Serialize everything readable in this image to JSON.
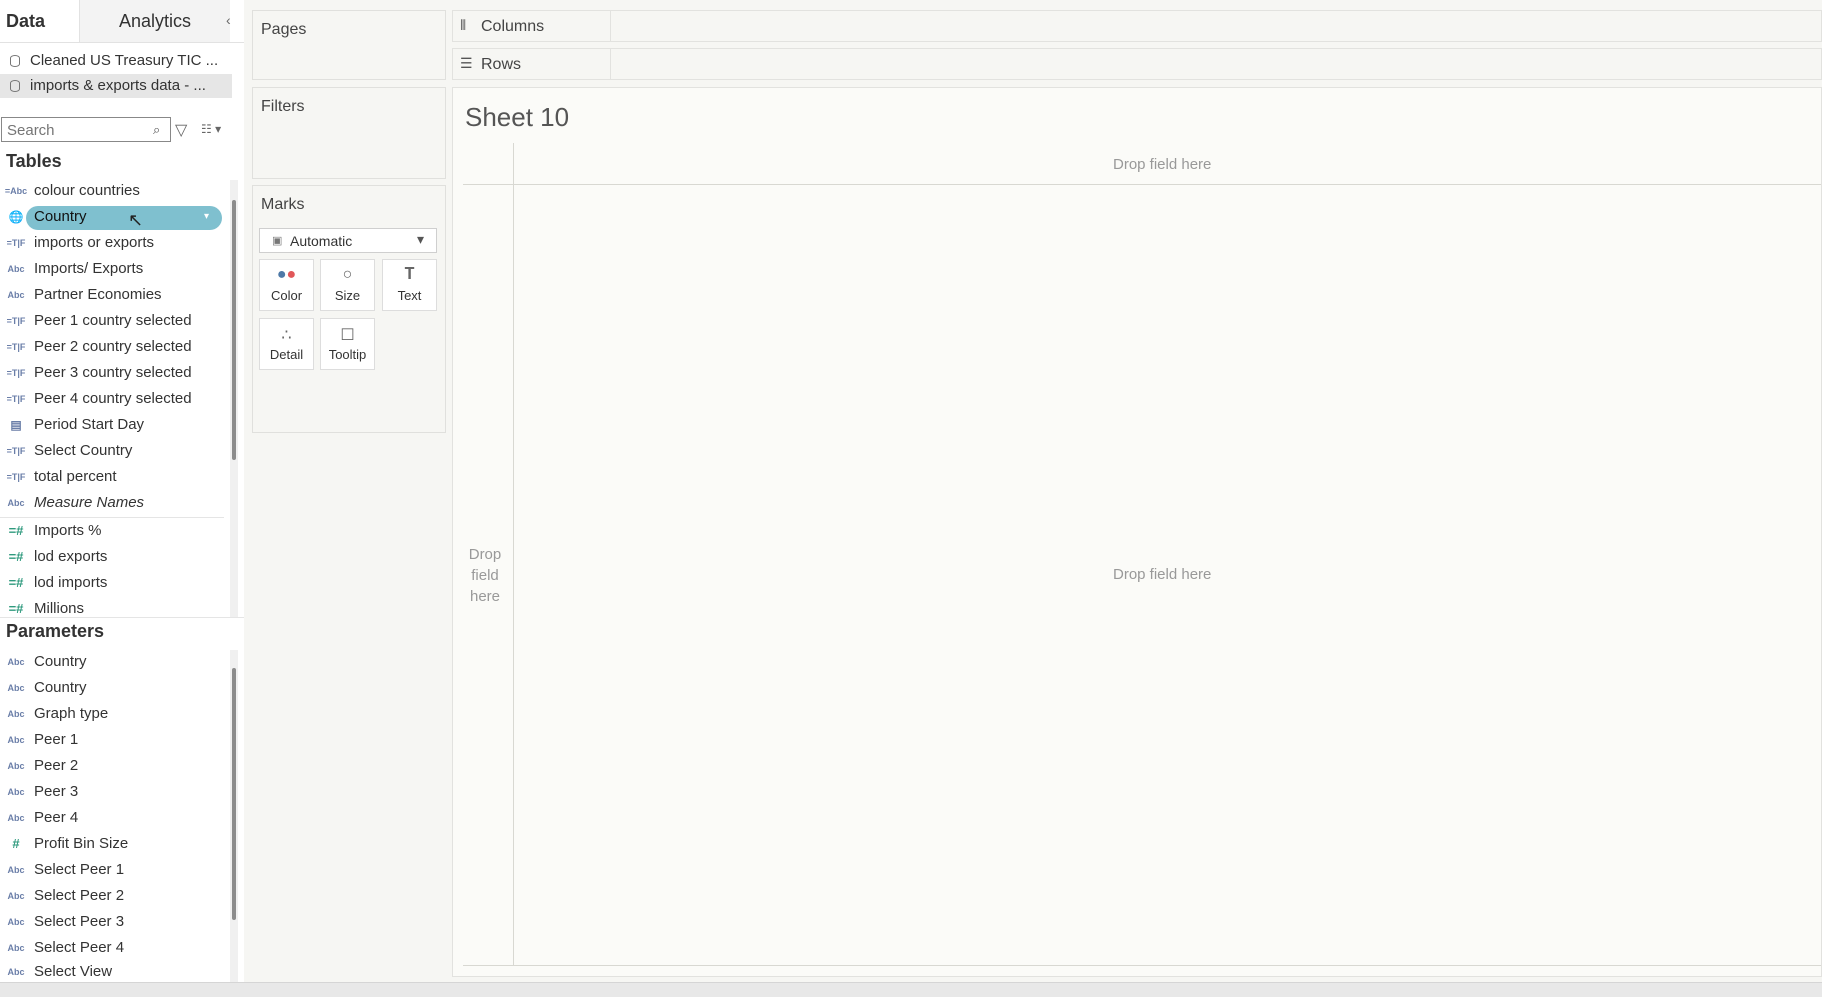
{
  "data_pane": {
    "tabs": {
      "data": "Data",
      "analytics": "Analytics"
    },
    "datasources": [
      "Cleaned US Treasury TIC ...",
      "imports & exports data - ..."
    ],
    "search": {
      "placeholder": "Search"
    },
    "tables_heading": "Tables",
    "tables": [
      {
        "type": "Abc",
        "label": "colour countries",
        "icon": "abc-calc-icon"
      },
      {
        "type": "geo",
        "label": "Country",
        "icon": "globe-icon",
        "selected": true
      },
      {
        "type": "TF",
        "label": "imports or exports",
        "icon": "boolean-calc-icon"
      },
      {
        "type": "Abc",
        "label": "Imports/ Exports",
        "icon": "abc-icon"
      },
      {
        "type": "Abc",
        "label": "Partner Economies",
        "icon": "abc-icon"
      },
      {
        "type": "TF",
        "label": "Peer 1 country selected",
        "icon": "boolean-calc-icon"
      },
      {
        "type": "TF",
        "label": "Peer 2 country selected",
        "icon": "boolean-calc-icon"
      },
      {
        "type": "TF",
        "label": "Peer 3 country selected",
        "icon": "boolean-calc-icon"
      },
      {
        "type": "TF",
        "label": "Peer 4 country selected",
        "icon": "boolean-calc-icon"
      },
      {
        "type": "date",
        "label": "Period Start Day",
        "icon": "calendar-icon"
      },
      {
        "type": "TF",
        "label": "Select Country",
        "icon": "boolean-calc-icon"
      },
      {
        "type": "TF",
        "label": "total percent",
        "icon": "boolean-calc-icon"
      },
      {
        "type": "Abc",
        "label": "Measure Names",
        "icon": "abc-icon",
        "italic": true
      }
    ],
    "measures": [
      {
        "label": "Imports %",
        "icon": "measure-calc-icon"
      },
      {
        "label": "lod exports",
        "icon": "measure-calc-icon"
      },
      {
        "label": "lod imports",
        "icon": "measure-calc-icon"
      },
      {
        "label": "Millions",
        "icon": "measure-calc-icon"
      }
    ],
    "parameters_heading": "Parameters",
    "parameters": [
      {
        "type": "Abc",
        "label": "Country"
      },
      {
        "type": "Abc",
        "label": "Country"
      },
      {
        "type": "Abc",
        "label": "Graph type"
      },
      {
        "type": "Abc",
        "label": "Peer 1"
      },
      {
        "type": "Abc",
        "label": "Peer 2"
      },
      {
        "type": "Abc",
        "label": "Peer 3"
      },
      {
        "type": "Abc",
        "label": "Peer 4"
      },
      {
        "type": "#",
        "label": "Profit Bin Size"
      },
      {
        "type": "Abc",
        "label": "Select Peer 1"
      },
      {
        "type": "Abc",
        "label": "Select Peer 2"
      },
      {
        "type": "Abc",
        "label": "Select Peer 3"
      },
      {
        "type": "Abc",
        "label": "Select Peer 4"
      },
      {
        "type": "Abc",
        "label": "Select View"
      }
    ]
  },
  "cards": {
    "pages": "Pages",
    "filters": "Filters",
    "marks": "Marks",
    "marks_type": "Automatic",
    "mark_buttons": [
      {
        "label": "Color",
        "icon": "color-icon"
      },
      {
        "label": "Size",
        "icon": "size-icon"
      },
      {
        "label": "Text",
        "icon": "text-icon"
      },
      {
        "label": "Detail",
        "icon": "detail-icon"
      },
      {
        "label": "Tooltip",
        "icon": "tooltip-icon"
      }
    ]
  },
  "shelves": {
    "columns": "Columns",
    "rows": "Rows"
  },
  "sheet": {
    "title": "Sheet 10",
    "drop_top": "Drop field here",
    "drop_left": "Drop field here",
    "drop_main": "Drop field here"
  },
  "colors": {
    "selected_pill": "#7fc0cf",
    "measure_icon": "#2f9a7e",
    "dimension_icon": "#6a7ea8"
  }
}
